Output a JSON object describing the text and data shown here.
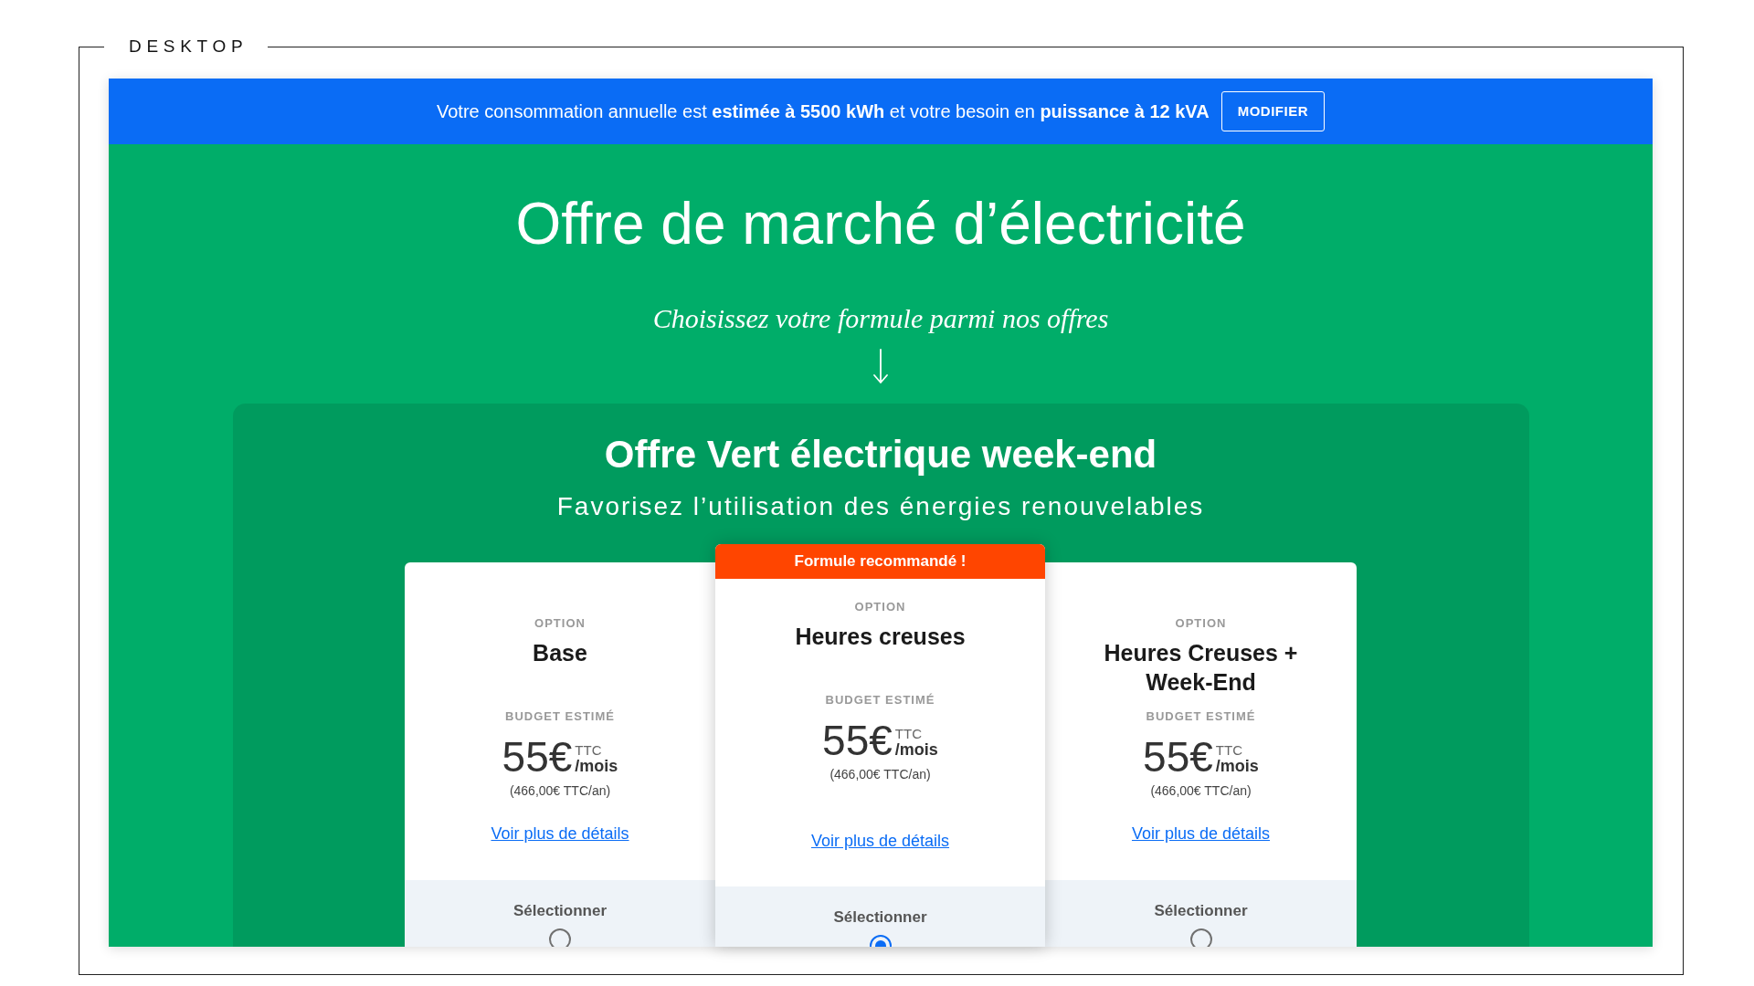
{
  "frame": {
    "label": "DESKTOP"
  },
  "banner": {
    "text": "Votre consommation annuelle est **estimée à 5500 kWh** et votre besoin en **puissance à 12 kVA**",
    "button": "MODIFIER"
  },
  "hero": {
    "title": "Offre de marché d’électricité",
    "subtitle": "Choisissez votre formule parmi nos offres"
  },
  "offer": {
    "title": "Offre Vert électrique week-end",
    "subtitle": "Favorisez l’utilisation des énergies renouvelables",
    "plans": [
      {
        "eyebrow": "OPTION",
        "name": "Base",
        "budget_label": "BUDGET ESTIMÉ",
        "price": "55€",
        "price_tax": "TTC",
        "price_period": "/mois",
        "annual": "(466,00€ TTC/an)",
        "details_link": "Voir plus de détails",
        "select_label": "Sélectionner",
        "selected": false
      },
      {
        "badge": "Formule recommandé !",
        "eyebrow": "OPTION",
        "name": "Heures creuses",
        "budget_label": "BUDGET ESTIMÉ",
        "price": "55€",
        "price_tax": "TTC",
        "price_period": "/mois",
        "annual": "(466,00€ TTC/an)",
        "details_link": "Voir plus de détails",
        "select_label": "Sélectionner",
        "selected": true
      },
      {
        "eyebrow": "OPTION",
        "name": "Heures Creuses + Week-End",
        "budget_label": "BUDGET ESTIMÉ",
        "price": "55€",
        "price_tax": "TTC",
        "price_period": "/mois",
        "annual": "(466,00€ TTC/an)",
        "details_link": "Voir plus de détails",
        "select_label": "Sélectionner",
        "selected": false
      }
    ]
  }
}
